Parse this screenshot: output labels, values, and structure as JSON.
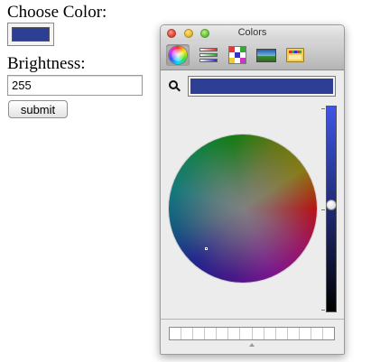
{
  "form": {
    "choose_color_label": "Choose Color:",
    "selected_color": "#2c3f95",
    "brightness_label": "Brightness:",
    "brightness_value": "255",
    "submit_label": "submit"
  },
  "colors_panel": {
    "title": "Colors",
    "toolbar": [
      "color-wheel-icon",
      "color-sliders-icon",
      "color-palettes-icon",
      "image-palettes-icon",
      "crayons-icon"
    ],
    "selected_tool": "color-wheel-icon",
    "current_color": "#2c3f95",
    "brightness_top_color": "#3f55e6",
    "brightness_level": 0.52,
    "swatch_count": 14
  }
}
